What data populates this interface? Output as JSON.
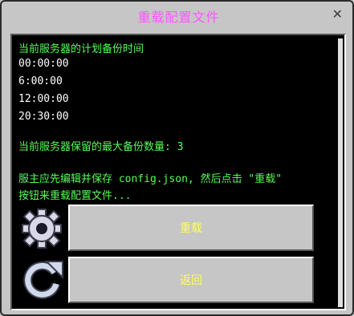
{
  "dialog": {
    "title": "重载配置文件",
    "close_glyph": "✕"
  },
  "console": {
    "schedule_heading": "当前服务器的计划备份时间",
    "times": [
      "00:00:00",
      "6:00:00",
      "12:00:00",
      "20:30:00"
    ],
    "max_backups_line": "当前服务器保留的最大备份数量: 3",
    "instruction_line1": "服主应先编辑并保存 config.json, 然后点击 \"重载\"",
    "instruction_line2": "按钮来重载配置文件..."
  },
  "buttons": {
    "reload_label": "重载",
    "back_label": "返回"
  },
  "icons": {
    "reload_icon": "gear-icon",
    "back_icon": "refresh-icon"
  },
  "colors": {
    "title": "#ff55ff",
    "text_green": "#55ff55",
    "text_white": "#ffffff",
    "button_label": "#ffff55",
    "panel_bg": "#000000",
    "frame_bg": "#c6c6c6"
  }
}
